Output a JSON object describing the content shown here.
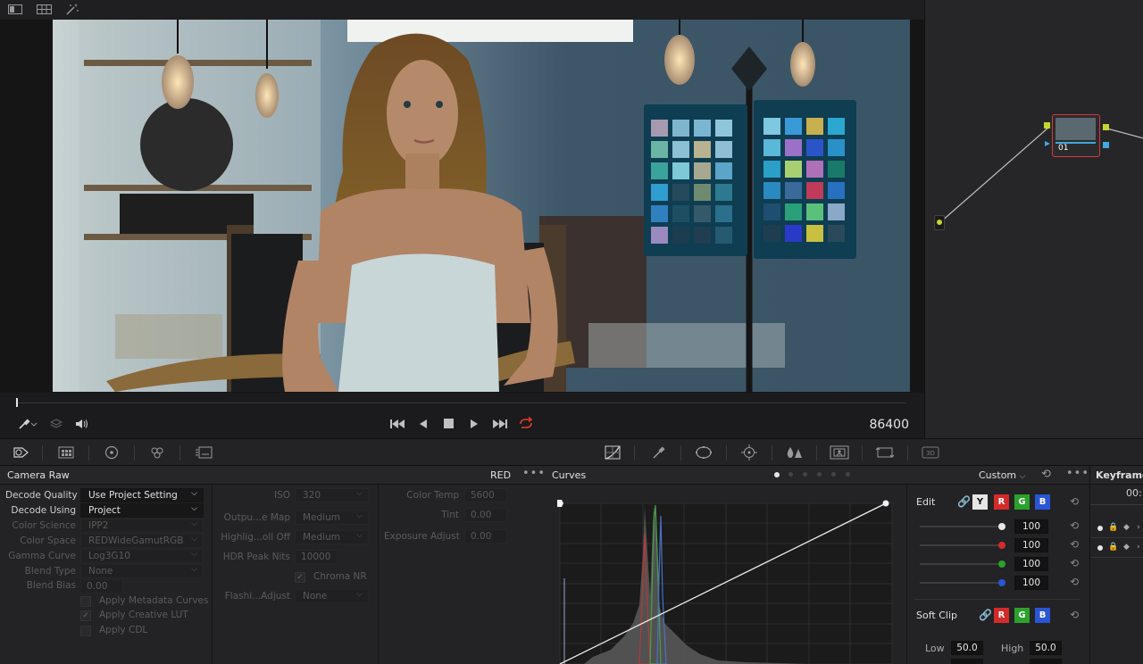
{
  "timecode": "86400",
  "node": {
    "label": "01"
  },
  "camera_raw": {
    "title": "Camera Raw",
    "format": "RED",
    "col1": [
      {
        "label": "Decode Quality",
        "value": "Use Project Setting",
        "enabled": true
      },
      {
        "label": "Decode Using",
        "value": "Project",
        "enabled": true
      },
      {
        "label": "Color Science",
        "value": "IPP2",
        "enabled": false
      },
      {
        "label": "Color Space",
        "value": "REDWideGamutRGB",
        "enabled": false
      },
      {
        "label": "Gamma Curve",
        "value": "Log3G10",
        "enabled": false
      },
      {
        "label": "Blend Type",
        "value": "None",
        "enabled": false
      }
    ],
    "blend_bias": {
      "label": "Blend Bias",
      "value": "0.00"
    },
    "checks": [
      {
        "label": "Apply Metadata Curves",
        "checked": false
      },
      {
        "label": "Apply Creative LUT",
        "checked": true
      },
      {
        "label": "Apply CDL",
        "checked": false
      }
    ],
    "col2": {
      "iso": {
        "label": "ISO",
        "value": "320"
      },
      "output_map": {
        "label": "Outpu...e Map",
        "value": "Medium"
      },
      "highlight_roll": {
        "label": "Highlig...oll Off",
        "value": "Medium"
      },
      "hdr_peak": {
        "label": "HDR Peak Nits",
        "value": "10000"
      },
      "chroma_nr": {
        "label": "Chroma NR",
        "checked": true
      },
      "flash_adjust": {
        "label": "Flashi...Adjust",
        "value": "None"
      }
    },
    "col3": {
      "color_temp": {
        "label": "Color Temp",
        "value": "5600"
      },
      "tint": {
        "label": "Tint",
        "value": "0.00"
      },
      "exposure": {
        "label": "Exposure Adjust",
        "value": "0.00"
      }
    }
  },
  "curves": {
    "title": "Curves",
    "mode": "Custom",
    "edit_label": "Edit",
    "channels": [
      "Y",
      "R",
      "G",
      "B"
    ],
    "values": [
      "100",
      "100",
      "100",
      "100"
    ],
    "soft_clip_label": "Soft Clip",
    "soft_clip_channels": [
      "R",
      "G",
      "B"
    ],
    "low_label": "Low",
    "low_value": "50.0",
    "high_label": "High",
    "high_value": "50.0"
  },
  "keyframes": {
    "title": "Keyframes",
    "time": "00:"
  },
  "colors": {
    "accent_red": "#e03c31",
    "node_border": "#d23a3a"
  }
}
